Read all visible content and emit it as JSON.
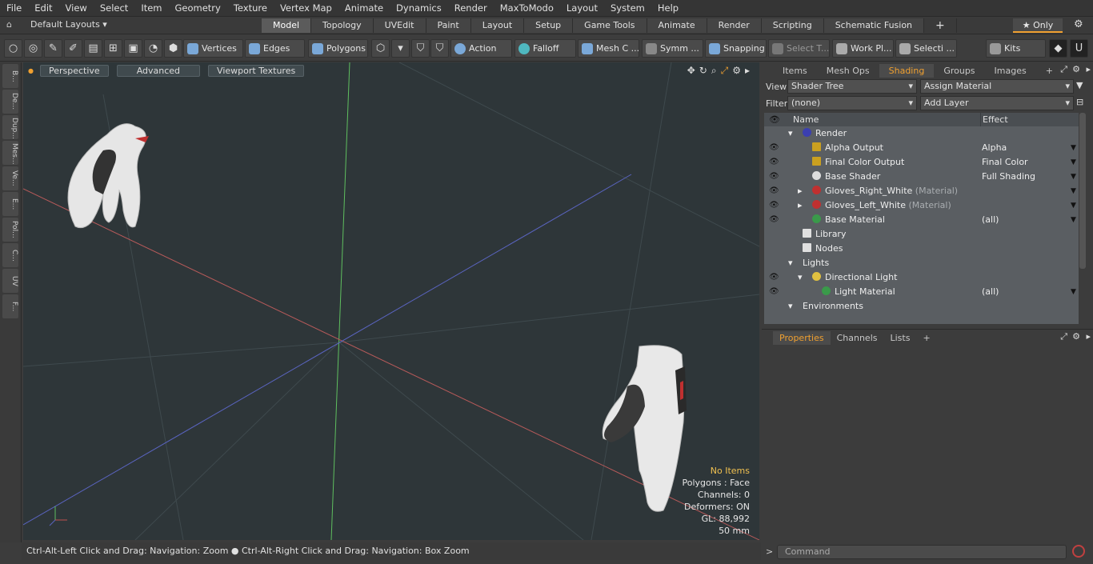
{
  "menu": [
    "File",
    "Edit",
    "View",
    "Select",
    "Item",
    "Geometry",
    "Texture",
    "Vertex Map",
    "Animate",
    "Dynamics",
    "Render",
    "MaxToModo",
    "Layout",
    "System",
    "Help"
  ],
  "layout_label": "Default Layouts ▾",
  "main_tabs": [
    "Model",
    "Topology",
    "UVEdit",
    "Paint",
    "Layout",
    "Setup",
    "Game Tools",
    "Animate",
    "Render",
    "Scripting",
    "Schematic Fusion"
  ],
  "only_label": "★ Only",
  "toolbar": {
    "vertices": "Vertices",
    "edges": "Edges",
    "polygons": "Polygons",
    "action": "Action",
    "falloff": "Falloff",
    "mesh": "Mesh C ...",
    "symm": "Symm ...",
    "snapping": "Snapping",
    "select_t": "Select T...",
    "work_pl": "Work Pl...",
    "selecti": "Selecti ...",
    "kits": "Kits"
  },
  "left_tabs": [
    "B...",
    "De...",
    "Dup...",
    "Mes...",
    "Ve...",
    "E...",
    "Pol...",
    "C...",
    "UV",
    "F..."
  ],
  "viewport": {
    "perspective": "Perspective",
    "advanced": "Advanced",
    "textures": "Viewport Textures",
    "info": {
      "items": "No Items",
      "polygons": "Polygons : Face",
      "channels": "Channels: 0",
      "deformers": "Deformers: ON",
      "gl": "GL: 88,992",
      "mm": "50 mm"
    }
  },
  "status": "Ctrl-Alt-Left Click and Drag: Navigation: Zoom ● Ctrl-Alt-Right Click and Drag: Navigation: Box Zoom",
  "panel": {
    "tabs": [
      "Items",
      "Mesh Ops",
      "Shading",
      "Groups",
      "Images"
    ],
    "view_label": "View",
    "view_value": "Shader Tree",
    "assign": "Assign Material",
    "filter_label": "Filter",
    "filter_value": "(none)",
    "add_layer": "Add Layer",
    "col_name": "Name",
    "col_effect": "Effect",
    "rows": [
      {
        "name": "Render",
        "effect": ""
      },
      {
        "name": "Alpha Output",
        "effect": "Alpha"
      },
      {
        "name": "Final Color Output",
        "effect": "Final Color"
      },
      {
        "name": "Base Shader",
        "effect": "Full Shading"
      },
      {
        "name": "Gloves_Right_White",
        "sub": "(Material)",
        "effect": ""
      },
      {
        "name": "Gloves_Left_White",
        "sub": "(Material)",
        "effect": ""
      },
      {
        "name": "Base Material",
        "effect": "(all)"
      },
      {
        "name": "Library",
        "effect": ""
      },
      {
        "name": "Nodes",
        "effect": ""
      },
      {
        "name": "Lights",
        "effect": ""
      },
      {
        "name": "Directional Light",
        "effect": ""
      },
      {
        "name": "Light Material",
        "effect": "(all)"
      },
      {
        "name": "Environments",
        "effect": ""
      }
    ],
    "props_tabs": [
      "Properties",
      "Channels",
      "Lists"
    ],
    "command": "Command"
  },
  "colors": {
    "accent": "#f0a030",
    "viewport_bg": "#2e3639"
  }
}
